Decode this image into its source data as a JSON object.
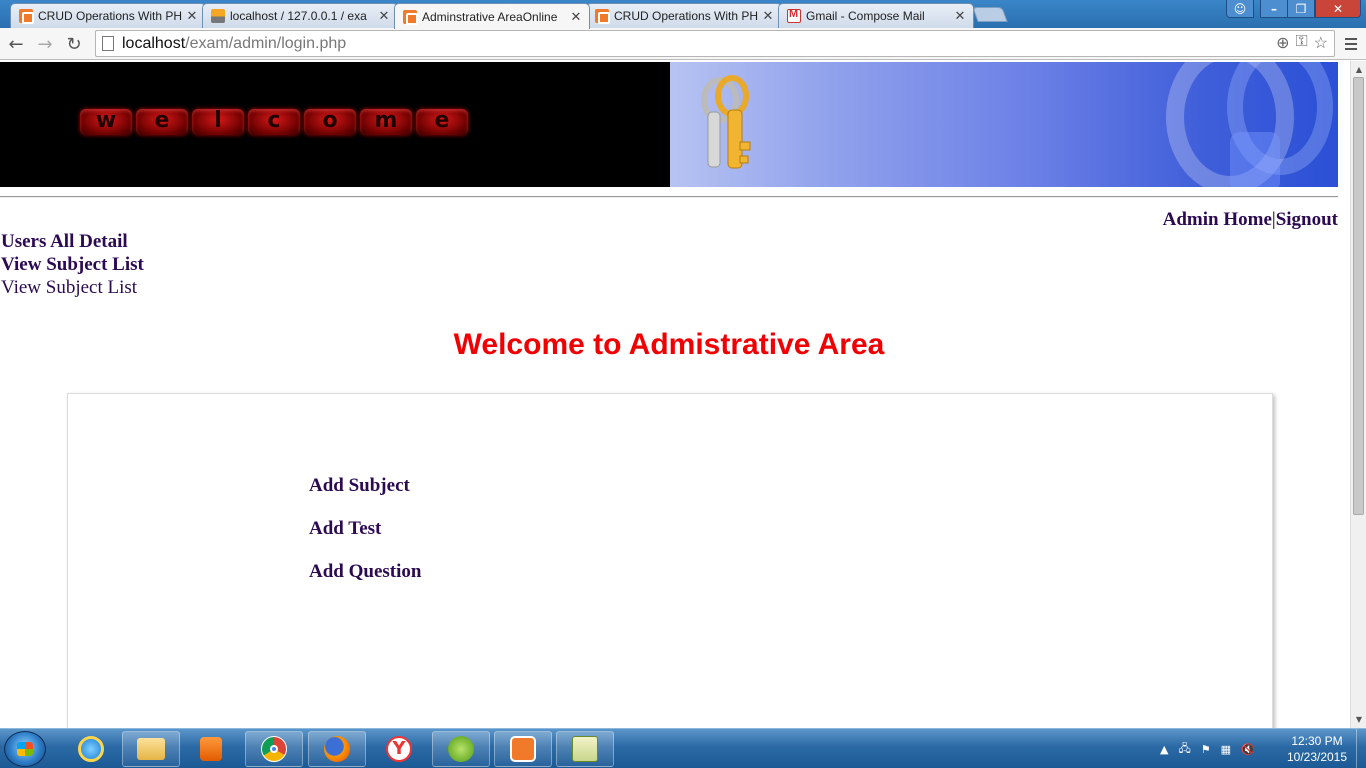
{
  "browser": {
    "tabs": [
      {
        "label": "CRUD Operations With PH",
        "icon": "xampp-icon"
      },
      {
        "label": "localhost / 127.0.0.1 / exa",
        "icon": "phpmyadmin-icon"
      },
      {
        "label": "Adminstrative AreaOnline",
        "icon": "xampp-icon",
        "active": true
      },
      {
        "label": "CRUD Operations With PH",
        "icon": "xampp-icon"
      },
      {
        "label": "Gmail - Compose Mail",
        "icon": "gmail-icon"
      }
    ],
    "url_host": "localhost",
    "url_path": "/exam/admin/login.php"
  },
  "banner": {
    "welcome_letters": [
      "w",
      "e",
      "l",
      "c",
      "o",
      "m",
      "e"
    ]
  },
  "nav": {
    "admin_home": "Admin Home",
    "separator": "|",
    "signout": "Signout",
    "users_all_detail": "Users All Detail",
    "view_subject_list_bold": "View Subject List",
    "view_subject_list": "View Subject List"
  },
  "page": {
    "title": "Welcome to Admistrative Area",
    "title_color": "#f00000",
    "link_color": "#2b0a52"
  },
  "panel": {
    "links": [
      "Add Subject",
      "Add Test",
      "Add Question"
    ]
  },
  "taskbar": {
    "apps": [
      "internet-explorer-icon",
      "file-explorer-icon",
      "media-player-icon",
      "chrome-icon",
      "firefox-icon",
      "yandex-icon",
      "dreamweaver-icon",
      "xampp-icon",
      "notepad-plus-plus-icon"
    ],
    "time": "12:30 PM",
    "date": "10/23/2015"
  }
}
